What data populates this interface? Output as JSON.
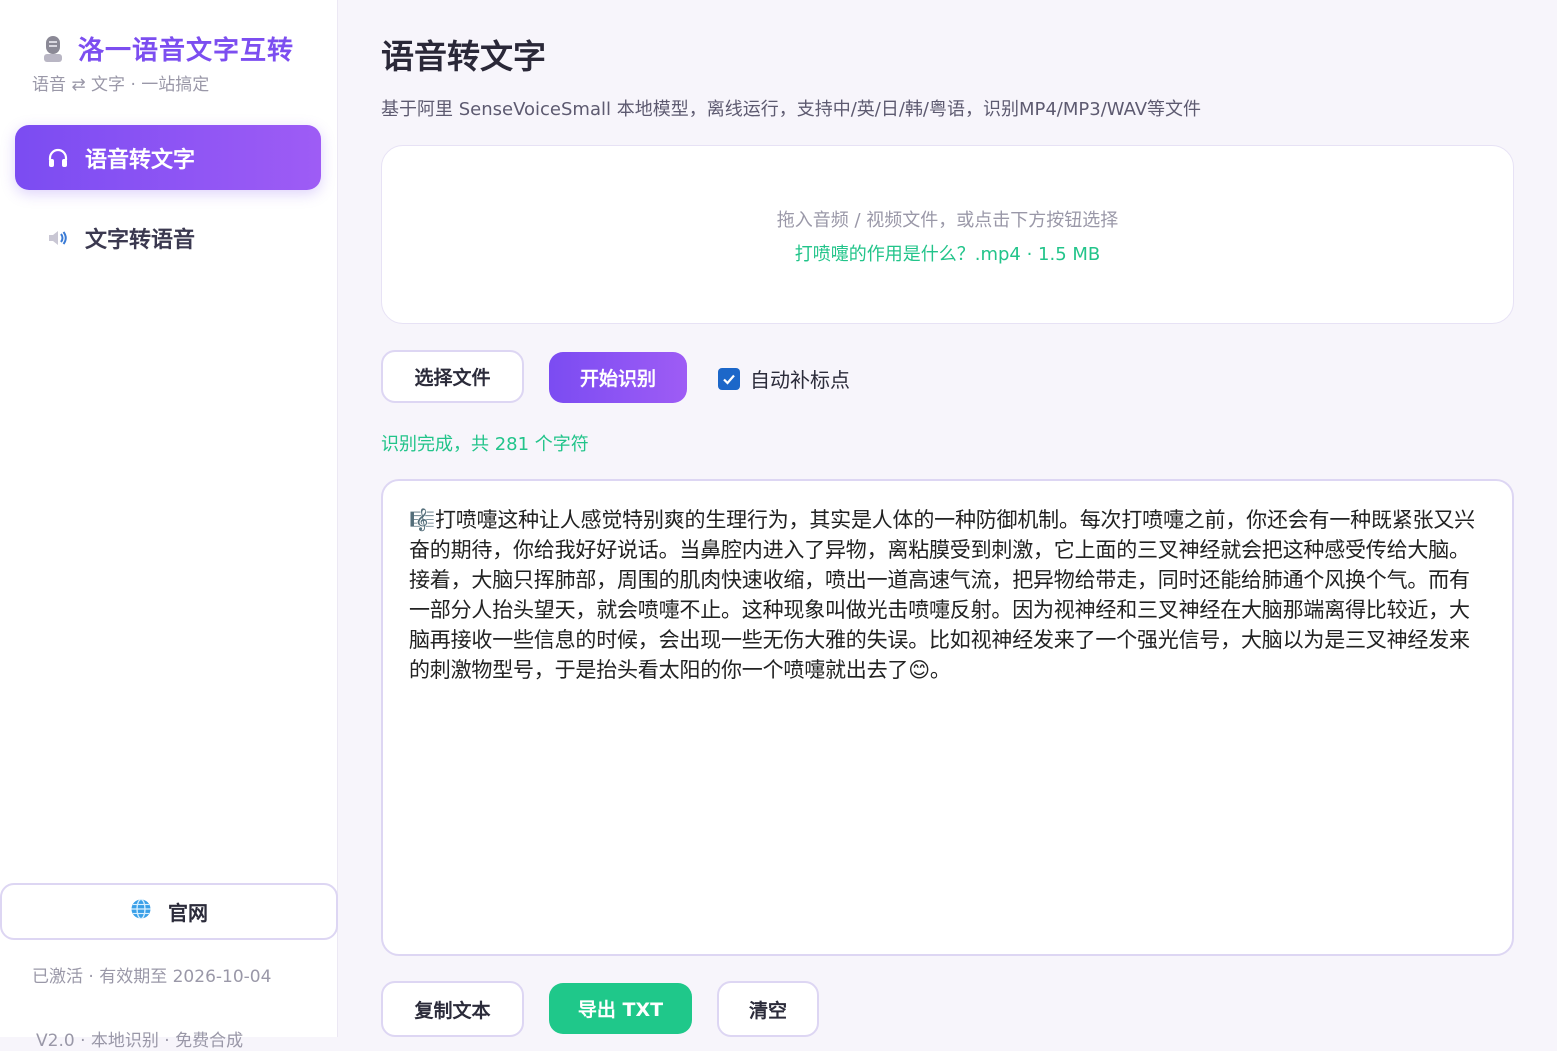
{
  "app": {
    "title": "洛一语音文字互转",
    "subtitle": "语音 ⇄ 文字 · 一站搞定",
    "icon": "microphone-icon"
  },
  "sidebar": {
    "items": [
      {
        "label": "语音转文字",
        "icon": "headphones-icon",
        "active": true
      },
      {
        "label": "文字转语音",
        "icon": "speaker-icon",
        "active": false
      }
    ],
    "site_button": {
      "label": "官网",
      "icon": "globe-icon"
    },
    "activation": "已激活 · 有效期至 2026-10-04",
    "version": "V2.0 · 本地识别 · 免费合成"
  },
  "main": {
    "title": "语音转文字",
    "description": "基于阿里 SenseVoiceSmall 本地模型，离线运行，支持中/英/日/韩/粤语，识别MP4/MP3/WAV等文件",
    "dropzone": {
      "hint": "拖入音频 / 视频文件，或点击下方按钮选择",
      "file": "打喷嚏的作用是什么？.mp4 · 1.5 MB"
    },
    "actions": {
      "choose_file": "选择文件",
      "start": "开始识别",
      "auto_punct_label": "自动补标点",
      "auto_punct_checked": true
    },
    "status": "识别完成，共 281 个字符",
    "result_text": "🎼打喷嚏这种让人感觉特别爽的生理行为，其实是人体的一种防御机制。每次打喷嚏之前，你还会有一种既紧张又兴奋的期待，你给我好好说话。当鼻腔内进入了异物，离粘膜受到刺激，它上面的三叉神经就会把这种感受传给大脑。接着，大脑只挥肺部，周围的肌肉快速收缩，喷出一道高速气流，把异物给带走，同时还能给肺通个风换个气。而有一部分人抬头望天，就会喷嚏不止。这种现象叫做光击喷嚏反射。因为视神经和三叉神经在大脑那端离得比较近，大脑再接收一些信息的时候，会出现一些无伤大雅的失误。比如视神经发来了一个强光信号，大脑以为是三叉神经发来的刺激物型号，于是抬头看太阳的你一个喷嚏就出去了😊。",
    "bottom_actions": {
      "copy": "复制文本",
      "export": "导出 TXT",
      "clear": "清空"
    }
  },
  "colors": {
    "accent": "#7c4ef0",
    "success": "#22c48a",
    "export_button": "#1fc88a",
    "checkbox": "#1c67c9"
  }
}
